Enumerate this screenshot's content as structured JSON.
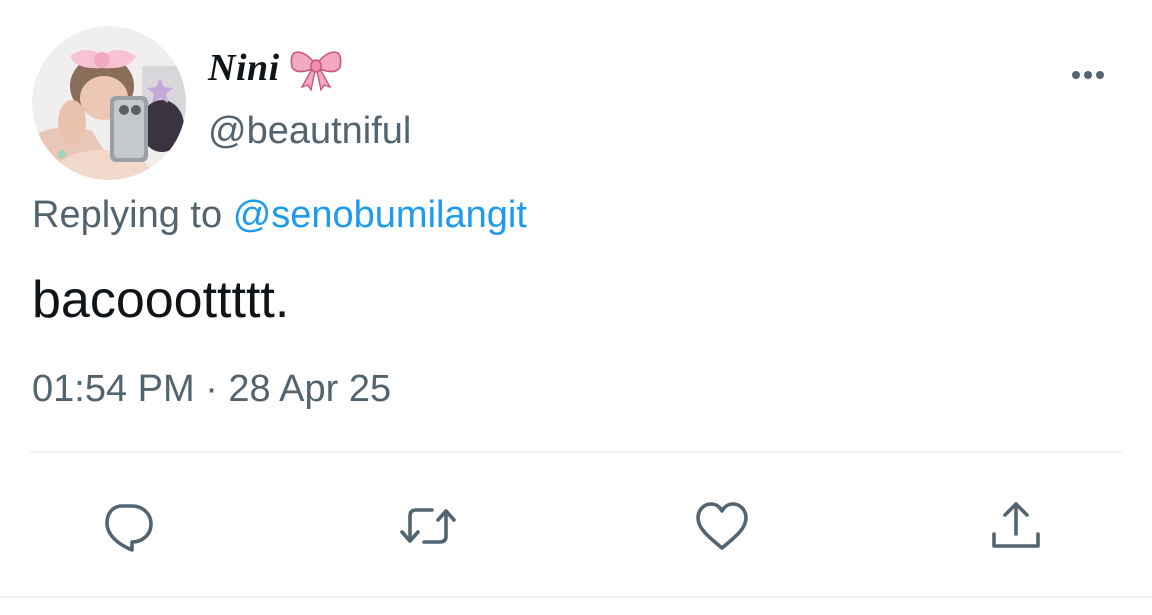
{
  "tweet": {
    "author": {
      "display_name": "Nini",
      "name_emoji": "ribbon-icon",
      "handle": "@beautniful",
      "avatar": "avatar"
    },
    "reply_context": {
      "prefix": "Replying to",
      "mention": "@senobumilangit"
    },
    "text": "bacooottttt.",
    "timestamp": "01:54 PM · 28 Apr 25",
    "more_icon": "more-horizontal-icon"
  },
  "actions": [
    {
      "name": "reply",
      "icon": "reply-bubble-icon"
    },
    {
      "name": "retweet",
      "icon": "retweet-icon"
    },
    {
      "name": "like",
      "icon": "heart-icon"
    },
    {
      "name": "share",
      "icon": "share-icon"
    }
  ],
  "colors": {
    "primary_text": "#0f1419",
    "secondary_text": "#536471",
    "link": "#1d9bf0",
    "divider": "#eff3f4",
    "icon": "#536471",
    "ribbon": "#f4a9c2"
  }
}
